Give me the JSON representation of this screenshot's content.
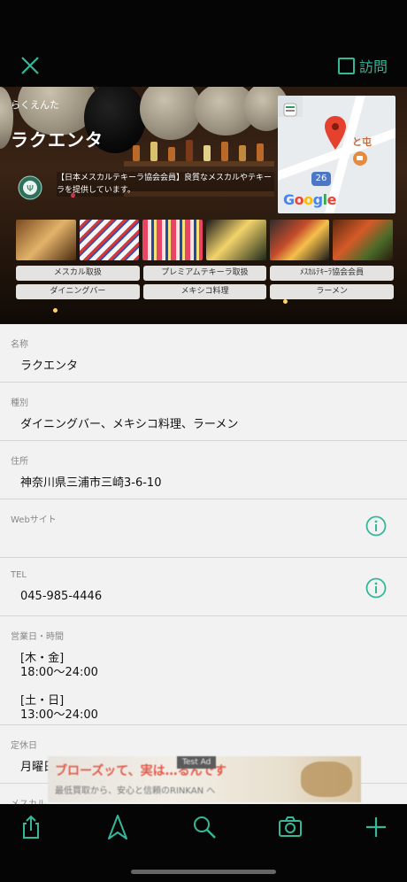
{
  "header": {
    "visit_label": "訪問"
  },
  "hero": {
    "name_reading": "らくえんた",
    "name": "ラクエンタ",
    "badge_text": "【日本メスカルテキーラ協会会員】良質なメスカルやテキーラを提供しています。",
    "map_logo": "Google",
    "map_route_number": "26",
    "tags": [
      "メスカル取扱",
      "プレミアムテキーラ取扱",
      "ﾒｽｶﾙﾃｷｰﾗ協会会員",
      "ダイニングバー",
      "メキシコ料理",
      "ラーメン"
    ]
  },
  "details": {
    "name_label": "名称",
    "name_value": "ラクエンタ",
    "category_label": "種別",
    "category_value": "ダイニングバー、メキシコ料理、ラーメン",
    "address_label": "住所",
    "address_value": "神奈川県三浦市三崎3-6-10",
    "website_label": "Webサイト",
    "tel_label": "TEL",
    "tel_value": "045-985-4446",
    "hours_label": "営業日・時間",
    "hours_day1": "[木・金]",
    "hours_time1": "18:00〜24:00",
    "hours_day2": "[土・日]",
    "hours_time2": "13:00〜24:00",
    "holiday_label": "定休日",
    "holiday_value": "月曜日",
    "mezcal_label": "メスカル"
  },
  "ad": {
    "line1": "ブローズッて、実は…るんです",
    "line2": "最低買取から、安心と信頼のRINKAN へ",
    "test_tag": "Test Ad"
  },
  "colors": {
    "accent": "#35b89a",
    "top_bar": "#050505",
    "tab_bar": "#050505"
  },
  "icons": {
    "close": "close-icon",
    "share": "share-icon",
    "navigate": "compass-arrow-icon",
    "search": "search-icon",
    "camera": "camera-icon",
    "add": "plus-icon",
    "info": "info-icon"
  }
}
